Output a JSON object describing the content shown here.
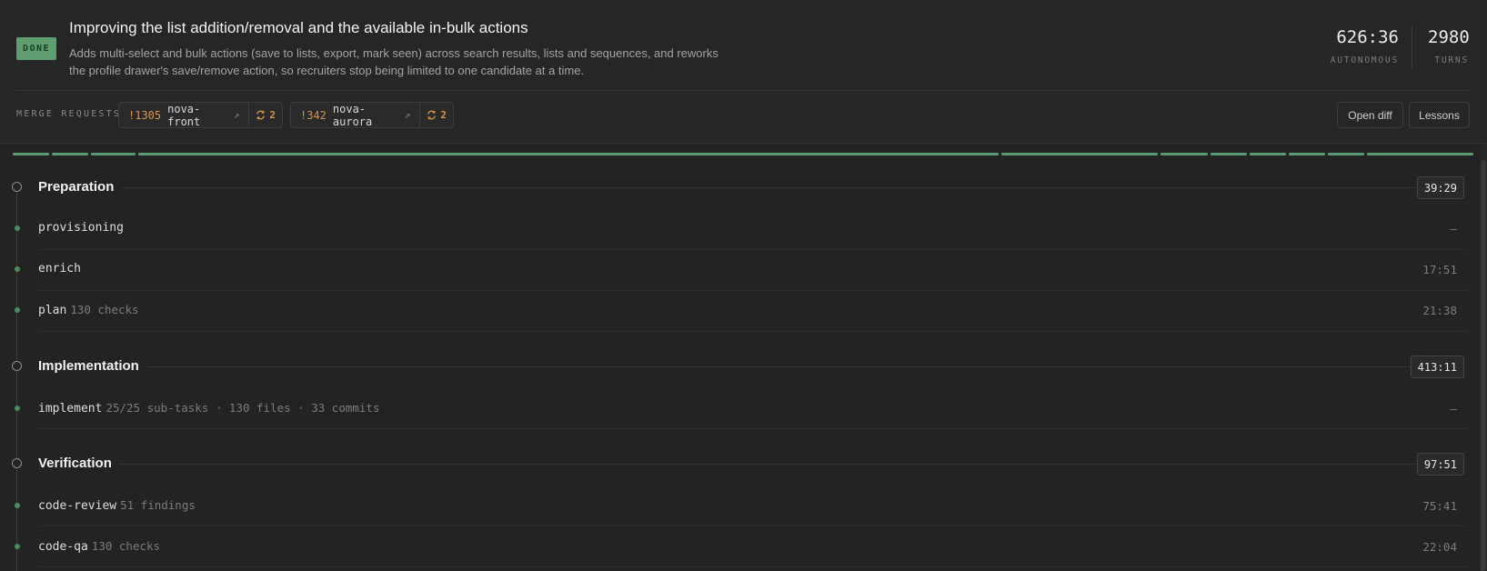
{
  "task": {
    "status": "DONE",
    "title": "Improving the list addition/removal and the available in-bulk actions",
    "description": "Adds multi-select and bulk actions (save to lists, export, mark seen) across search results, lists and sequences, and reworks the profile drawer's save/remove action, so recruiters stop being limited to one candidate at a time."
  },
  "stats": {
    "autonomous": {
      "value": "626:36",
      "label": "AUTONOMOUS"
    },
    "turns": {
      "value": "2980",
      "label": "TURNS"
    }
  },
  "merge_requests": {
    "label": "MERGE REQUESTS",
    "items": [
      {
        "id": "!1305",
        "repo": "nova-front",
        "sync_count": "2"
      },
      {
        "id": "!342",
        "repo": "nova-aurora",
        "sync_count": "2"
      }
    ]
  },
  "actions": {
    "open_diff": "Open diff",
    "lessons": "Lessons"
  },
  "colors": {
    "accent": "#5a9a70",
    "status_badge": "#5f9e70",
    "mr_id": "#d8944a"
  },
  "phases": [
    {
      "name": "Preparation",
      "time": "39:29",
      "steps": [
        {
          "name": "provisioning",
          "meta": "",
          "time": "—"
        },
        {
          "name": "enrich",
          "meta": "",
          "time": "17:51"
        },
        {
          "name": "plan",
          "meta": "130 checks",
          "time": "21:38"
        }
      ]
    },
    {
      "name": "Implementation",
      "time": "413:11",
      "steps": [
        {
          "name": "implement",
          "meta": "25/25 sub-tasks · 130 files · 33 commits",
          "time": "—"
        }
      ]
    },
    {
      "name": "Verification",
      "time": "97:51",
      "steps": [
        {
          "name": "code-review",
          "meta": "51 findings",
          "time": "75:41"
        },
        {
          "name": "code-qa",
          "meta": "130 checks",
          "time": "22:04"
        }
      ]
    }
  ]
}
